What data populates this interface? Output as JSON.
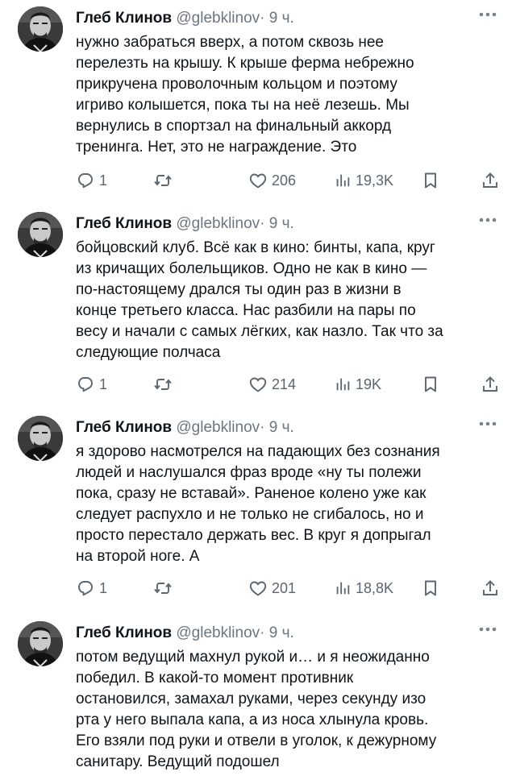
{
  "tweets": [
    {
      "name": "Глеб Клинов",
      "handle": "@glebklinov",
      "dot": "·",
      "time": "9 ч.",
      "lines": [
        "нужно забраться вверх, а потом сквозь нее",
        "перелезть на крышу. К крыше ферма небрежно",
        "прикручена проволочным кольцом и поэтому",
        "игриво колышется, пока ты на неё лезешь. Мы",
        "вернулись в спортзал на финальный аккорд",
        "тренинга. Нет, это не награждение. Это"
      ],
      "replies": "1",
      "likes": "206",
      "views": "19,3K"
    },
    {
      "name": "Глеб Клинов",
      "handle": "@glebklinov",
      "dot": "·",
      "time": "9 ч.",
      "lines": [
        "бойцовский клуб. Всё как в кино: бинты, капа, круг",
        "из кричащих болельщиков. Одно не как в кино —",
        "по-настоящему дрался ты один раз в жизни в",
        "конце третьего класса. Нас разбили на пары по",
        "весу и начали с самых лёгких, как назло. Так что за",
        "следующие полчаса"
      ],
      "replies": "1",
      "likes": "214",
      "views": "19K"
    },
    {
      "name": "Глеб Клинов",
      "handle": "@glebklinov",
      "dot": "·",
      "time": "9 ч.",
      "lines": [
        "я здорово насмотрелся на падающих без сознания",
        "людей и наслушался фраз вроде «ну ты полежи",
        "пока, сразу не вставай». Раненое колено уже как",
        "следует распухло и не только не сгибалось, но и",
        "просто перестало держать вес. В круг я допрыгал",
        "на второй ноге. А"
      ],
      "replies": "1",
      "likes": "201",
      "views": "18,8K"
    },
    {
      "name": "Глеб Клинов",
      "handle": "@glebklinov",
      "dot": "·",
      "time": "9 ч.",
      "lines": [
        "потом ведущий махнул рукой и… и я неожиданно",
        "победил. В какой-то момент противник",
        "остановился, замахал руками, через секунду изо",
        "рта у него выпала капа, а из носа хлынула кровь.",
        "Его взяли под руки и отвели в уголок, к дежурному",
        "санитару. Ведущий подошел"
      ]
    }
  ]
}
